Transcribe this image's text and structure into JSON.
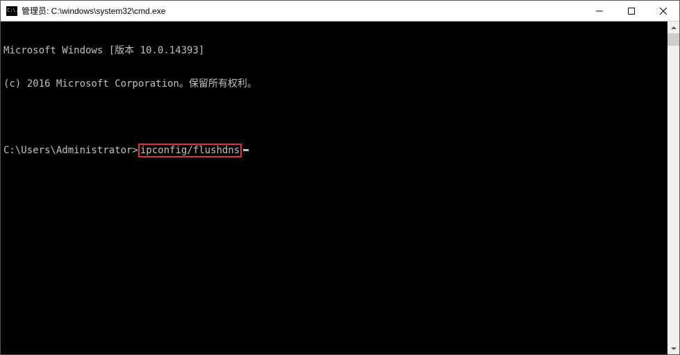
{
  "titlebar": {
    "icon_text": "C:\\.",
    "title": "管理员: C:\\windows\\system32\\cmd.exe"
  },
  "terminal": {
    "line1": "Microsoft Windows [版本 10.0.14393]",
    "line2": "(c) 2016 Microsoft Corporation。保留所有权利。",
    "prompt": "C:\\Users\\Administrator>",
    "command": "ipconfig/flushdns"
  }
}
